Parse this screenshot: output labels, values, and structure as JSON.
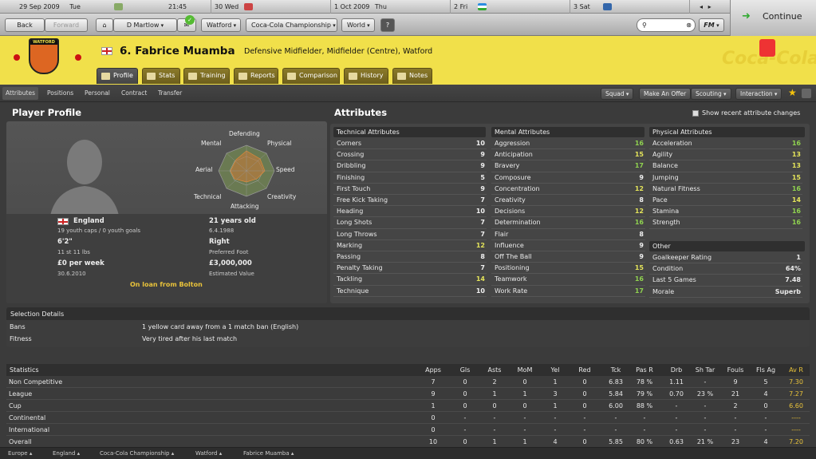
{
  "calendar": [
    {
      "date": "29 Sep 2009",
      "day": "Tue",
      "time": "21:45"
    },
    {
      "date": "30",
      "day": "Wed"
    },
    {
      "date": "1 Oct 2009",
      "day": "Thu"
    },
    {
      "date": "2",
      "day": "Fri"
    },
    {
      "date": "3",
      "day": "Sat"
    }
  ],
  "nav": {
    "back": "Back",
    "forward": "Forward",
    "manager": "D Martlow",
    "club": "Watford",
    "competition": "Coca-Cola Championship",
    "world": "World",
    "help": "?",
    "continue": "Continue",
    "fm": "FM"
  },
  "player": {
    "title": "6. Fabrice Muamba",
    "position": "Defensive Midfielder, Midfielder (Centre), Watford",
    "club_badge": "WATFORD"
  },
  "tabs": [
    {
      "label": "Profile",
      "active": true
    },
    {
      "label": "Stats"
    },
    {
      "label": "Training"
    },
    {
      "label": "Reports"
    },
    {
      "label": "Comparison"
    },
    {
      "label": "History"
    },
    {
      "label": "Notes"
    }
  ],
  "subnav": [
    "Attributes",
    "Positions",
    "Personal",
    "Contract",
    "Transfer"
  ],
  "actions": [
    "Squad",
    "Make An Offer",
    "Scouting",
    "Interaction"
  ],
  "profile": {
    "title": "Player Profile",
    "nation": "England",
    "caps": "19 youth caps / 0 youth goals",
    "height": "6'2\"",
    "weight": "11 st 11 lbs",
    "wage": "£0 per week",
    "contract": "30.6.2010",
    "age": "21 years old",
    "dob": "6.4.1988",
    "foot": "Right",
    "foot_label": "Preferred Foot",
    "value": "£3,000,000",
    "value_label": "Estimated Value",
    "loan": "On loan from Bolton",
    "radar": [
      "Defending",
      "Physical",
      "Speed",
      "Creativity",
      "Attacking",
      "Technical",
      "Aerial",
      "Mental"
    ]
  },
  "attributes": {
    "title": "Attributes",
    "recent_toggle": "Show recent attribute changes",
    "technical_title": "Technical Attributes",
    "technical": [
      [
        "Corners",
        "10"
      ],
      [
        "Crossing",
        "9"
      ],
      [
        "Dribbling",
        "9"
      ],
      [
        "Finishing",
        "5"
      ],
      [
        "First Touch",
        "9"
      ],
      [
        "Free Kick Taking",
        "7"
      ],
      [
        "Heading",
        "10"
      ],
      [
        "Long Shots",
        "7"
      ],
      [
        "Long Throws",
        "7"
      ],
      [
        "Marking",
        "12"
      ],
      [
        "Passing",
        "8"
      ],
      [
        "Penalty Taking",
        "7"
      ],
      [
        "Tackling",
        "14"
      ],
      [
        "Technique",
        "10"
      ]
    ],
    "mental_title": "Mental Attributes",
    "mental": [
      [
        "Aggression",
        "16"
      ],
      [
        "Anticipation",
        "15"
      ],
      [
        "Bravery",
        "17"
      ],
      [
        "Composure",
        "9"
      ],
      [
        "Concentration",
        "12"
      ],
      [
        "Creativity",
        "8"
      ],
      [
        "Decisions",
        "12"
      ],
      [
        "Determination",
        "16"
      ],
      [
        "Flair",
        "8"
      ],
      [
        "Influence",
        "9"
      ],
      [
        "Off The Ball",
        "9"
      ],
      [
        "Positioning",
        "15"
      ],
      [
        "Teamwork",
        "16"
      ],
      [
        "Work Rate",
        "17"
      ]
    ],
    "physical_title": "Physical Attributes",
    "physical": [
      [
        "Acceleration",
        "16"
      ],
      [
        "Agility",
        "13"
      ],
      [
        "Balance",
        "13"
      ],
      [
        "Jumping",
        "15"
      ],
      [
        "Natural Fitness",
        "16"
      ],
      [
        "Pace",
        "14"
      ],
      [
        "Stamina",
        "16"
      ],
      [
        "Strength",
        "16"
      ]
    ],
    "other_title": "Other",
    "other": [
      [
        "Goalkeeper Rating",
        "1"
      ],
      [
        "Condition",
        "64%"
      ],
      [
        "Last 5 Games",
        "7.48"
      ],
      [
        "Morale",
        "Superb"
      ]
    ]
  },
  "selection": {
    "title": "Selection Details",
    "rows": [
      [
        "Bans",
        "1 yellow card away from a 1 match ban (English)"
      ],
      [
        "Fitness",
        "Very tired after his last match"
      ]
    ]
  },
  "statistics": {
    "title": "Statistics",
    "columns": [
      "Apps",
      "Gls",
      "Asts",
      "MoM",
      "Yel",
      "Red",
      "Tck",
      "Pas R",
      "Drb",
      "Sh Tar",
      "Fouls",
      "Fls Ag",
      "Av R"
    ],
    "rows": [
      [
        "Non Competitive",
        "7",
        "0",
        "2",
        "0",
        "1",
        "0",
        "6.83",
        "78 %",
        "1.11",
        "-",
        "9",
        "5",
        "7.30"
      ],
      [
        "League",
        "9",
        "0",
        "1",
        "1",
        "3",
        "0",
        "5.84",
        "79 %",
        "0.70",
        "23 %",
        "21",
        "4",
        "7.27"
      ],
      [
        "Cup",
        "1",
        "0",
        "0",
        "0",
        "1",
        "0",
        "6.00",
        "88 %",
        "-",
        "-",
        "2",
        "0",
        "6.60"
      ],
      [
        "Continental",
        "0",
        "-",
        "-",
        "-",
        "-",
        "-",
        "-",
        "-",
        "-",
        "-",
        "-",
        "-",
        "----"
      ],
      [
        "International",
        "0",
        "-",
        "-",
        "-",
        "-",
        "-",
        "-",
        "-",
        "-",
        "-",
        "-",
        "-",
        "----"
      ],
      [
        "Overall",
        "10",
        "0",
        "1",
        "1",
        "4",
        "0",
        "5.85",
        "80 %",
        "0.63",
        "21 %",
        "23",
        "4",
        "7.20"
      ]
    ]
  },
  "breadcrumbs": [
    "Europe",
    "England",
    "Coca-Cola Championship",
    "Watford",
    "Fabrice Muamba"
  ],
  "colors": {
    "high": "#8fd14f",
    "mid": "#e3e35a",
    "header": "#f1e04a",
    "avr": "#e8c23a"
  }
}
